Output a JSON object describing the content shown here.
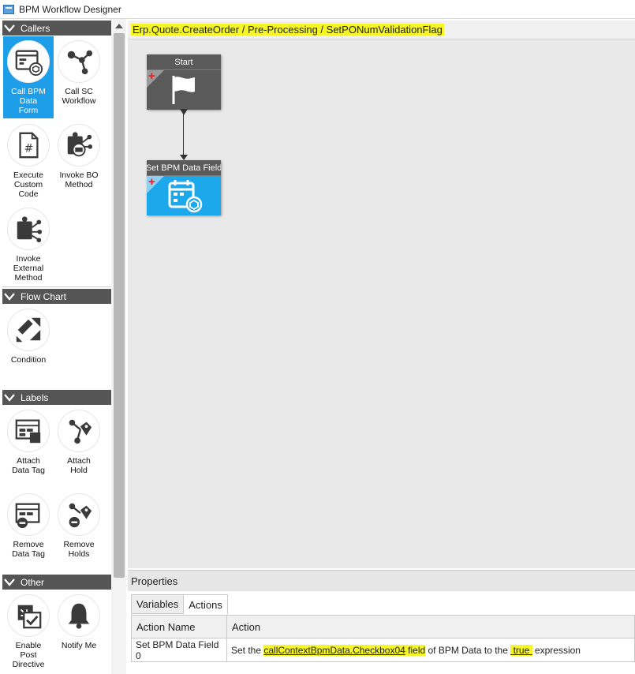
{
  "window": {
    "title": "BPM Workflow Designer"
  },
  "toolbox": {
    "groups": [
      {
        "label": "Callers"
      },
      {
        "label": "Flow Chart"
      },
      {
        "label": "Labels"
      },
      {
        "label": "Other"
      }
    ],
    "tools": {
      "call_bpm_data_form": "Call BPM\nData\nForm",
      "call_sc_workflow": "Call SC\nWorkflow",
      "execute_custom_code": "Execute\nCustom\nCode",
      "invoke_bo_method": "Invoke BO\nMethod",
      "invoke_external_method": "Invoke\nExternal\nMethod",
      "condition": "Condition",
      "attach_data_tag": "Attach\nData Tag",
      "attach_hold": "Attach\nHold",
      "remove_data_tag": "Remove\nData Tag",
      "remove_holds": "Remove\nHolds",
      "enable_post_directive": "Enable\nPost\nDirective",
      "notify_me": "Notify Me"
    }
  },
  "breadcrumb": "Erp.Quote.CreateOrder / Pre-Processing / SetPONumValidationFlag",
  "canvas": {
    "nodes": [
      {
        "title": "Start"
      },
      {
        "title": "Set BPM Data Field"
      }
    ]
  },
  "properties": {
    "header": "Properties",
    "tabs": [
      {
        "label": "Variables"
      },
      {
        "label": "Actions"
      }
    ],
    "columns": [
      "Action Name",
      "Action"
    ],
    "rows": [
      {
        "name": "Set BPM Data Field 0",
        "action_prefix": "Set the ",
        "field_link": "callContextBpmData.Checkbox04",
        "field_tail": " field",
        "action_middle": " of BPM Data to the ",
        "value_link": " true ",
        "action_suffix": " expression"
      }
    ]
  },
  "colors": {
    "selected_tool": "#1e9ee8",
    "highlight": "#f5f52a",
    "node_dark": "#5a5a5a",
    "node_blue": "#1ea8ec"
  }
}
